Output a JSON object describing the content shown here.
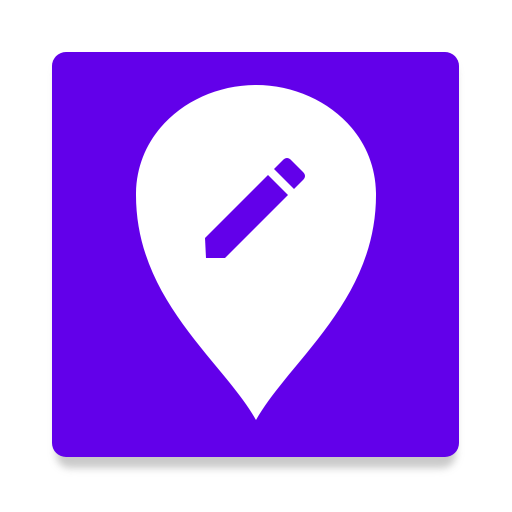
{
  "app_icon": {
    "name": "map-pin-edit",
    "tile_color": "#6200EA",
    "pin_color": "#FFFFFF",
    "pencil_color": "#6200EA",
    "shadow_color": "#9E9E9E"
  }
}
